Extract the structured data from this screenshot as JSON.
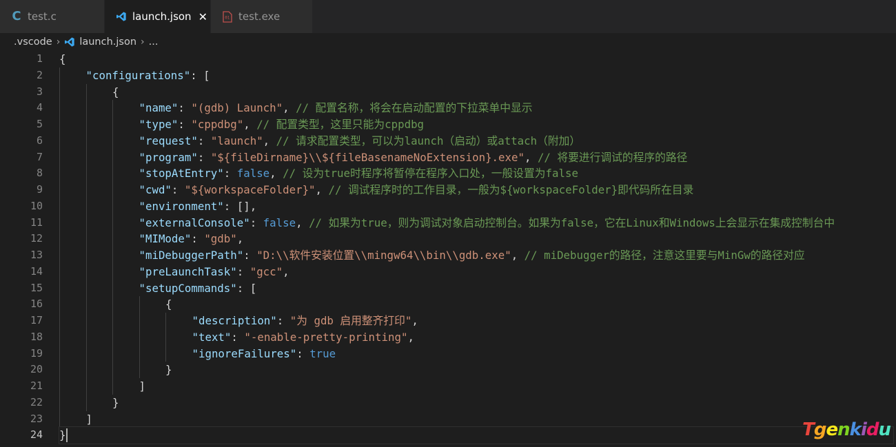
{
  "tabs": [
    {
      "label": "test.c",
      "icon": "c-file-icon",
      "active": false
    },
    {
      "label": "launch.json",
      "icon": "vscode-icon",
      "active": true,
      "close": "✕"
    },
    {
      "label": "test.exe",
      "icon": "binary-file-icon",
      "active": false
    }
  ],
  "breadcrumb": {
    "folder": ".vscode",
    "file": "launch.json",
    "more": "..."
  },
  "editor": {
    "current_line": 24,
    "line_numbers": [
      "1",
      "2",
      "3",
      "4",
      "5",
      "6",
      "7",
      "8",
      "9",
      "10",
      "11",
      "12",
      "13",
      "14",
      "15",
      "16",
      "17",
      "18",
      "19",
      "20",
      "21",
      "22",
      "23",
      "24"
    ],
    "lines": [
      {
        "indent": 0,
        "tokens": [
          {
            "t": "punc",
            "v": "{"
          }
        ]
      },
      {
        "indent": 1,
        "tokens": [
          {
            "t": "key",
            "v": "\"configurations\""
          },
          {
            "t": "punc",
            "v": ": ["
          }
        ]
      },
      {
        "indent": 2,
        "tokens": [
          {
            "t": "punc",
            "v": "{"
          }
        ]
      },
      {
        "indent": 3,
        "tokens": [
          {
            "t": "key",
            "v": "\"name\""
          },
          {
            "t": "punc",
            "v": ": "
          },
          {
            "t": "str",
            "v": "\"(gdb) Launch\""
          },
          {
            "t": "punc",
            "v": ", "
          },
          {
            "t": "cmt",
            "v": "// 配置名称，将会在启动配置的下拉菜单中显示"
          }
        ]
      },
      {
        "indent": 3,
        "tokens": [
          {
            "t": "key",
            "v": "\"type\""
          },
          {
            "t": "punc",
            "v": ": "
          },
          {
            "t": "str",
            "v": "\"cppdbg\""
          },
          {
            "t": "punc",
            "v": ", "
          },
          {
            "t": "cmt",
            "v": "// 配置类型，这里只能为cppdbg"
          }
        ]
      },
      {
        "indent": 3,
        "tokens": [
          {
            "t": "key",
            "v": "\"request\""
          },
          {
            "t": "punc",
            "v": ": "
          },
          {
            "t": "str",
            "v": "\"launch\""
          },
          {
            "t": "punc",
            "v": ", "
          },
          {
            "t": "cmt",
            "v": "// 请求配置类型，可以为launch（启动）或attach（附加）"
          }
        ]
      },
      {
        "indent": 3,
        "tokens": [
          {
            "t": "key",
            "v": "\"program\""
          },
          {
            "t": "punc",
            "v": ": "
          },
          {
            "t": "str",
            "v": "\"${fileDirname}\\\\${fileBasenameNoExtension}.exe\""
          },
          {
            "t": "punc",
            "v": ", "
          },
          {
            "t": "cmt",
            "v": "// 将要进行调试的程序的路径"
          }
        ]
      },
      {
        "indent": 3,
        "tokens": [
          {
            "t": "key",
            "v": "\"stopAtEntry\""
          },
          {
            "t": "punc",
            "v": ": "
          },
          {
            "t": "kw",
            "v": "false"
          },
          {
            "t": "punc",
            "v": ", "
          },
          {
            "t": "cmt",
            "v": "// 设为true时程序将暂停在程序入口处，一般设置为false"
          }
        ]
      },
      {
        "indent": 3,
        "tokens": [
          {
            "t": "key",
            "v": "\"cwd\""
          },
          {
            "t": "punc",
            "v": ": "
          },
          {
            "t": "str",
            "v": "\"${workspaceFolder}\""
          },
          {
            "t": "punc",
            "v": ", "
          },
          {
            "t": "cmt",
            "v": "// 调试程序时的工作目录，一般为${workspaceFolder}即代码所在目录"
          }
        ]
      },
      {
        "indent": 3,
        "tokens": [
          {
            "t": "key",
            "v": "\"environment\""
          },
          {
            "t": "punc",
            "v": ": [],"
          }
        ]
      },
      {
        "indent": 3,
        "tokens": [
          {
            "t": "key",
            "v": "\"externalConsole\""
          },
          {
            "t": "punc",
            "v": ": "
          },
          {
            "t": "kw",
            "v": "false"
          },
          {
            "t": "punc",
            "v": ", "
          },
          {
            "t": "cmt",
            "v": "// 如果为true，则为调试对象启动控制台。如果为false，它在Linux和Windows上会显示在集成控制台中"
          }
        ]
      },
      {
        "indent": 3,
        "tokens": [
          {
            "t": "key",
            "v": "\"MIMode\""
          },
          {
            "t": "punc",
            "v": ": "
          },
          {
            "t": "str",
            "v": "\"gdb\""
          },
          {
            "t": "punc",
            "v": ","
          }
        ]
      },
      {
        "indent": 3,
        "tokens": [
          {
            "t": "key",
            "v": "\"miDebuggerPath\""
          },
          {
            "t": "punc",
            "v": ": "
          },
          {
            "t": "str",
            "v": "\"D:\\\\软件安装位置\\\\mingw64\\\\bin\\\\gdb.exe\""
          },
          {
            "t": "punc",
            "v": ", "
          },
          {
            "t": "cmt",
            "v": "// miDebugger的路径，注意这里要与MinGw的路径对应"
          }
        ]
      },
      {
        "indent": 3,
        "tokens": [
          {
            "t": "key",
            "v": "\"preLaunchTask\""
          },
          {
            "t": "punc",
            "v": ": "
          },
          {
            "t": "str",
            "v": "\"gcc\""
          },
          {
            "t": "punc",
            "v": ","
          }
        ]
      },
      {
        "indent": 3,
        "tokens": [
          {
            "t": "key",
            "v": "\"setupCommands\""
          },
          {
            "t": "punc",
            "v": ": ["
          }
        ]
      },
      {
        "indent": 4,
        "tokens": [
          {
            "t": "punc",
            "v": "{"
          }
        ]
      },
      {
        "indent": 5,
        "tokens": [
          {
            "t": "key",
            "v": "\"description\""
          },
          {
            "t": "punc",
            "v": ": "
          },
          {
            "t": "str",
            "v": "\"为 gdb 启用整齐打印\""
          },
          {
            "t": "punc",
            "v": ","
          }
        ]
      },
      {
        "indent": 5,
        "tokens": [
          {
            "t": "key",
            "v": "\"text\""
          },
          {
            "t": "punc",
            "v": ": "
          },
          {
            "t": "str",
            "v": "\"-enable-pretty-printing\""
          },
          {
            "t": "punc",
            "v": ","
          }
        ]
      },
      {
        "indent": 5,
        "tokens": [
          {
            "t": "key",
            "v": "\"ignoreFailures\""
          },
          {
            "t": "punc",
            "v": ": "
          },
          {
            "t": "kw",
            "v": "true"
          }
        ]
      },
      {
        "indent": 4,
        "tokens": [
          {
            "t": "punc",
            "v": "}"
          }
        ]
      },
      {
        "indent": 3,
        "tokens": [
          {
            "t": "punc",
            "v": "]"
          }
        ]
      },
      {
        "indent": 2,
        "tokens": [
          {
            "t": "punc",
            "v": "}"
          }
        ]
      },
      {
        "indent": 1,
        "tokens": [
          {
            "t": "punc",
            "v": "]"
          }
        ]
      },
      {
        "indent": 0,
        "tokens": [
          {
            "t": "punc",
            "v": "}"
          }
        ]
      }
    ]
  },
  "watermark": {
    "letters": [
      "T",
      "g",
      "e",
      "n",
      "k",
      "i",
      "d",
      "u"
    ],
    "colors": [
      "#e8453c",
      "#f5a623",
      "#f8e71c",
      "#7ed321",
      "#4a90e2",
      "#9b59b6",
      "#e91e63",
      "#50e3c2"
    ]
  },
  "colors": {
    "background": "#1e1e1e",
    "key": "#9cdcfe",
    "string": "#ce9178",
    "keyword": "#569cd6",
    "comment": "#6a9955"
  }
}
